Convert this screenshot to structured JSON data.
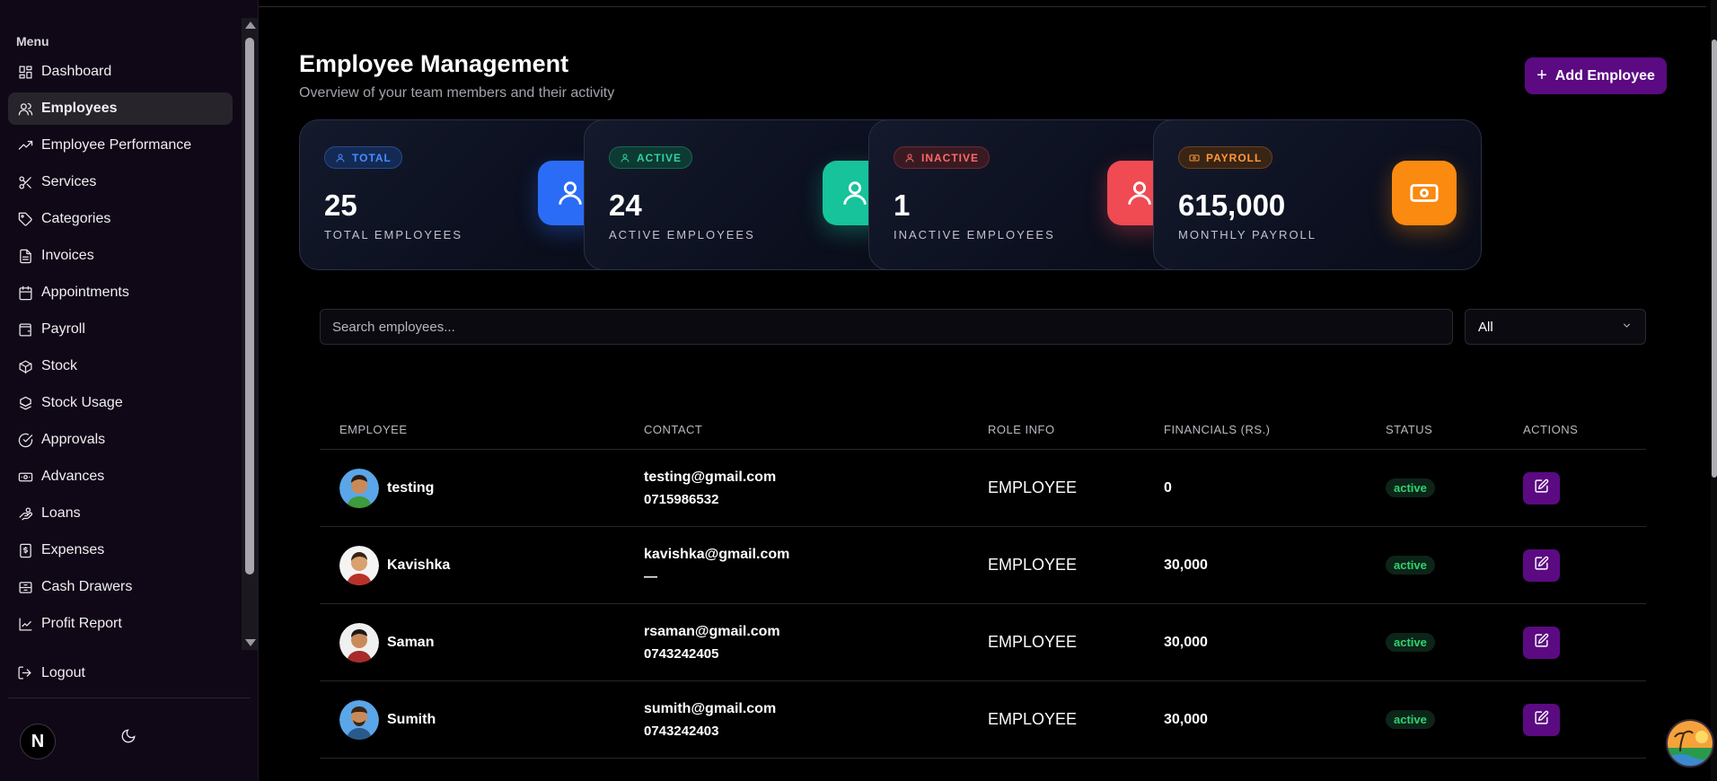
{
  "sidebar": {
    "menu_title": "Menu",
    "items": [
      {
        "label": "Dashboard",
        "icon": "dashboard-icon"
      },
      {
        "label": "Employees",
        "icon": "users-icon"
      },
      {
        "label": "Employee Performance",
        "icon": "trending-icon"
      },
      {
        "label": "Services",
        "icon": "scissors-icon"
      },
      {
        "label": "Categories",
        "icon": "tag-icon"
      },
      {
        "label": "Invoices",
        "icon": "file-icon"
      },
      {
        "label": "Appointments",
        "icon": "calendar-icon"
      },
      {
        "label": "Payroll",
        "icon": "wallet-icon"
      },
      {
        "label": "Stock",
        "icon": "box-icon"
      },
      {
        "label": "Stock Usage",
        "icon": "boxes-icon"
      },
      {
        "label": "Approvals",
        "icon": "check-circle-icon"
      },
      {
        "label": "Advances",
        "icon": "banknote-icon"
      },
      {
        "label": "Loans",
        "icon": "handcoins-icon"
      },
      {
        "label": "Expenses",
        "icon": "receipt-icon"
      },
      {
        "label": "Cash Drawers",
        "icon": "drawer-icon"
      },
      {
        "label": "Profit Report",
        "icon": "chart-icon"
      }
    ],
    "active_item": "Employees",
    "logout_label": "Logout",
    "brand_letter": "N"
  },
  "header": {
    "title": "Employee Management",
    "subtitle": "Overview of your team members and their activity",
    "add_button_label": "Add Employee"
  },
  "stats": [
    {
      "pill": "TOTAL",
      "value": "25",
      "label": "TOTAL EMPLOYEES",
      "pill_color": "#4a8cff",
      "pill_bg": "#132a55",
      "icon_bg": "#2b6cf6"
    },
    {
      "pill": "ACTIVE",
      "value": "24",
      "label": "ACTIVE EMPLOYEES",
      "pill_color": "#2fd3a0",
      "pill_bg": "#0d3a33",
      "icon_bg": "#17c39a"
    },
    {
      "pill": "INACTIVE",
      "value": "1",
      "label": "INACTIVE EMPLOYEES",
      "pill_color": "#ff6a6a",
      "pill_bg": "#3a1a22",
      "icon_bg": "#f04a52"
    },
    {
      "pill": "PAYROLL",
      "value": "615,000",
      "label": "MONTHLY PAYROLL",
      "pill_color": "#ff9a3a",
      "pill_bg": "#3a2414",
      "icon_bg": "#fa8a10"
    }
  ],
  "filters": {
    "search_placeholder": "Search employees...",
    "status_selected": "All"
  },
  "table": {
    "columns": [
      "EMPLOYEE",
      "CONTACT",
      "ROLE INFO",
      "FINANCIALS (RS.)",
      "STATUS",
      "ACTIONS"
    ],
    "rows": [
      {
        "name": "testing",
        "email": "testing@gmail.com",
        "phone": "0715986532",
        "role": "EMPLOYEE",
        "financials": "0",
        "status": "active"
      },
      {
        "name": "Kavishka",
        "email": "kavishka@gmail.com",
        "phone": "—",
        "role": "EMPLOYEE",
        "financials": "30,000",
        "status": "active"
      },
      {
        "name": "Saman",
        "email": "rsaman@gmail.com",
        "phone": "0743242405",
        "role": "EMPLOYEE",
        "financials": "30,000",
        "status": "active"
      },
      {
        "name": "Sumith",
        "email": "sumith@gmail.com",
        "phone": "0743242403",
        "role": "EMPLOYEE",
        "financials": "30,000",
        "status": "active"
      }
    ]
  },
  "colors": {
    "accent": "#5b0a82",
    "status_active": "#2fd36f"
  }
}
